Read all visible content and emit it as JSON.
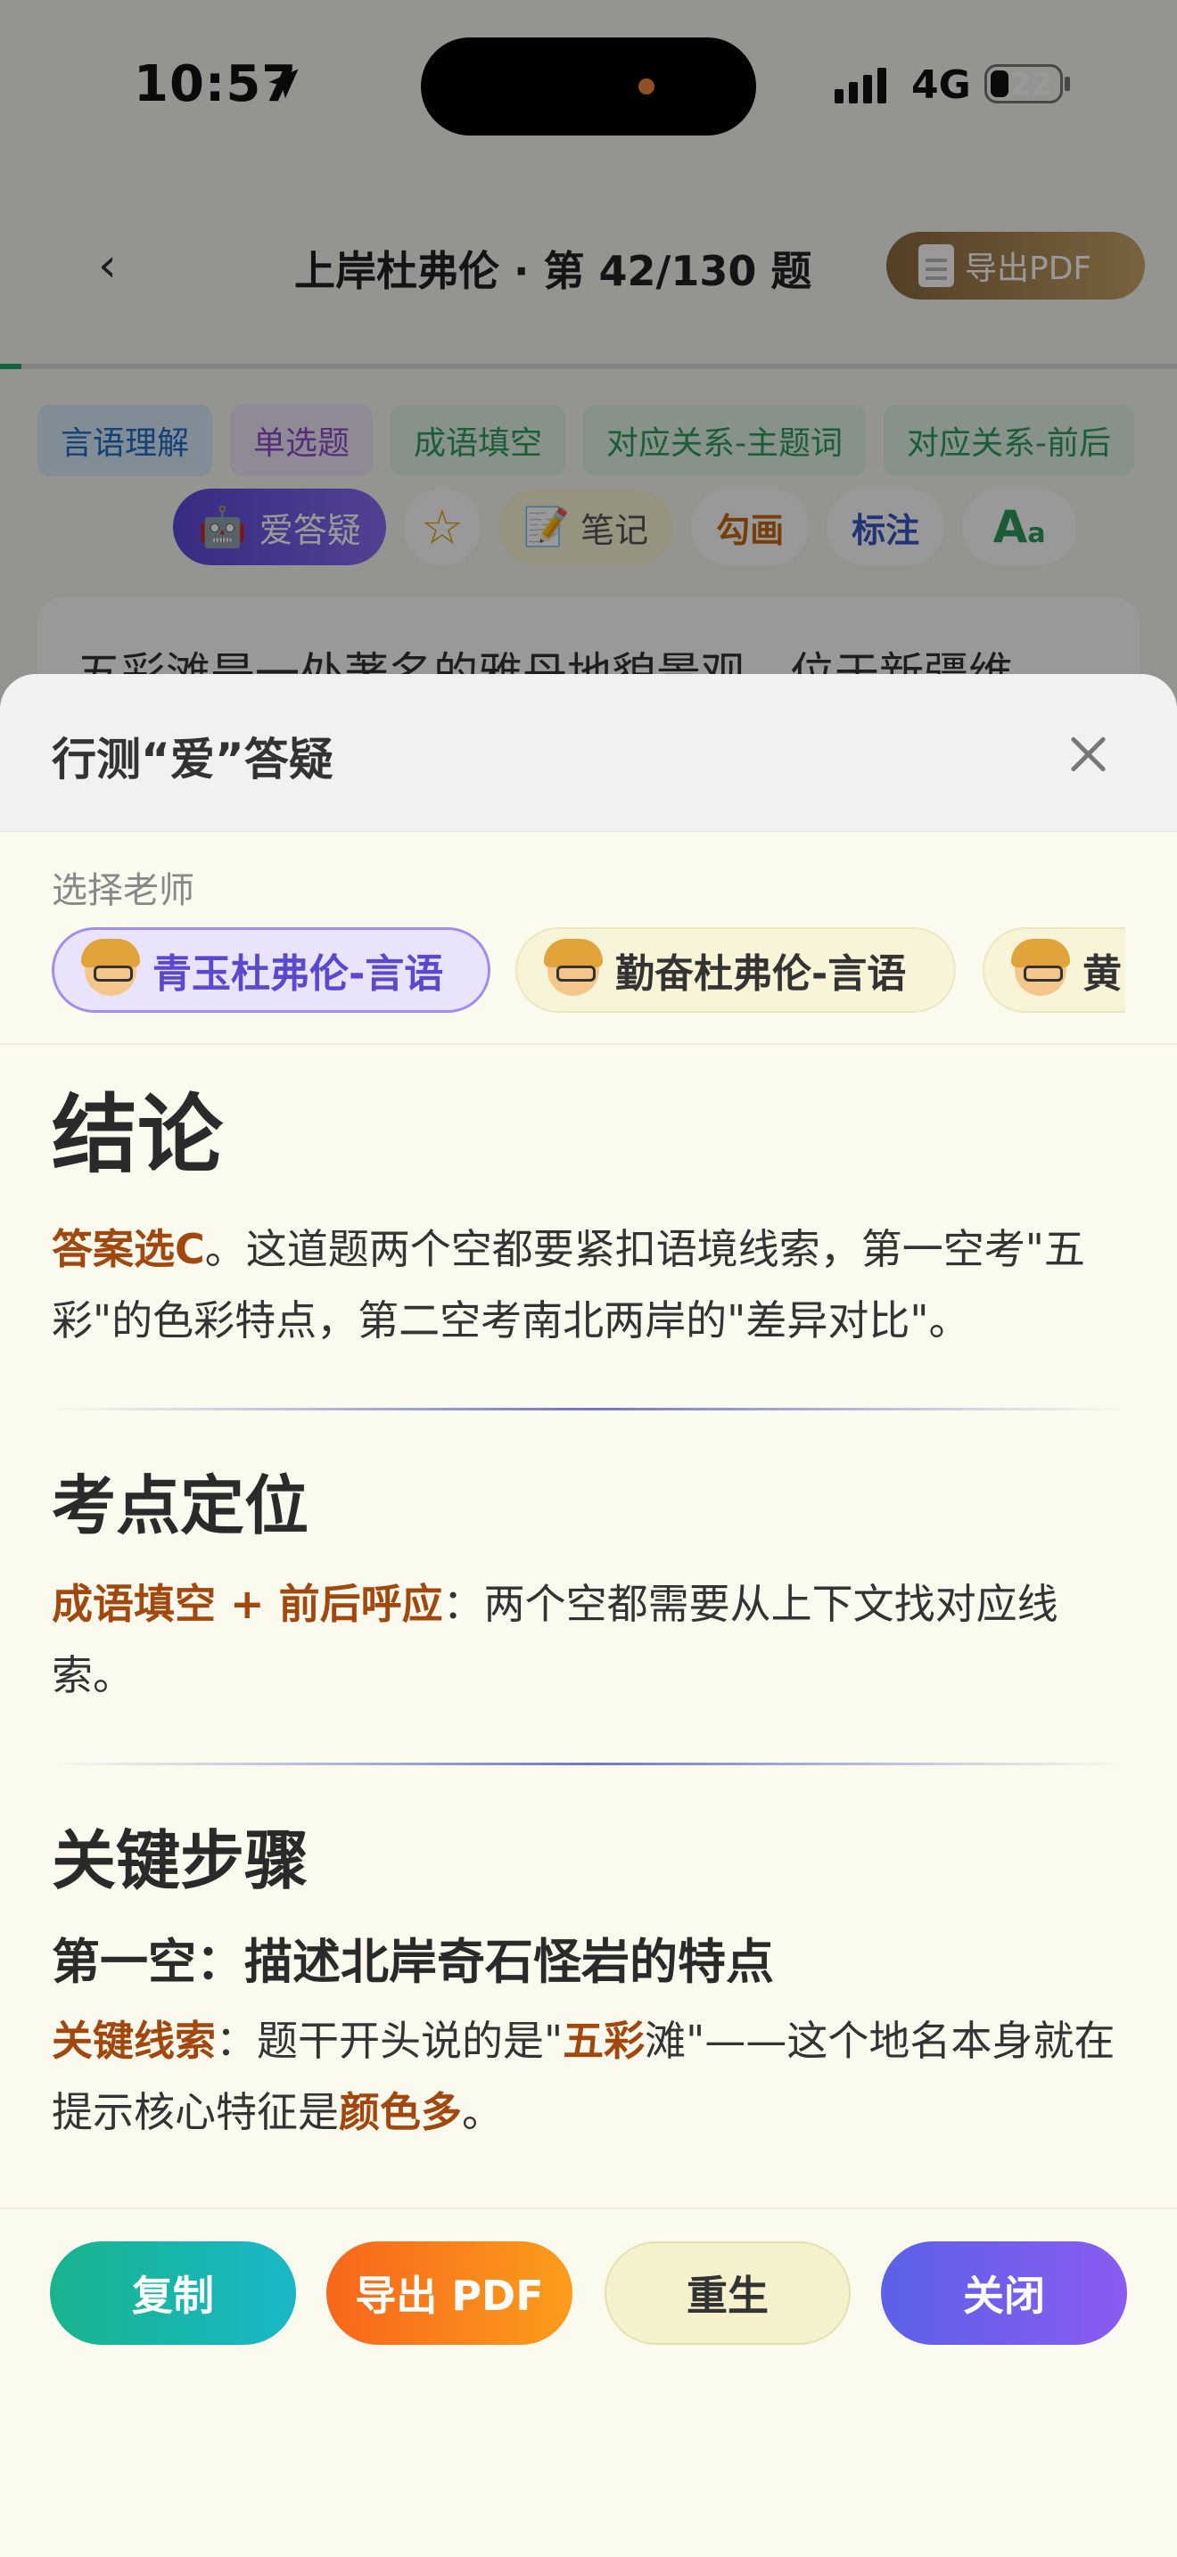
{
  "status": {
    "time": "10:57",
    "network": "4G",
    "battery": "22"
  },
  "nav": {
    "back": "‹",
    "title": "上岸杜弗伦 · 第 42/130 题",
    "export": "导出PDF"
  },
  "tags": [
    "言语理解",
    "单选题",
    "成语填空",
    "对应关系-主题词",
    "对应关系-前后"
  ],
  "toolbar": {
    "ai": "爱答疑",
    "star": "☆",
    "note": "笔记",
    "draw": "勾画",
    "mark": "标注",
    "font_big": "A",
    "font_small": "a"
  },
  "question_preview": "五彩滩是一处著名的雅丹地貌景观，位于新疆维",
  "sheet": {
    "title": "行测“爱”答疑",
    "choose_label": "选择老师",
    "teachers": [
      "青玉杜弗伦-言语",
      "勤奋杜弗伦-言语",
      "黄"
    ],
    "sections": {
      "conclusion": {
        "heading": "结论",
        "lead": "答案选C",
        "text": "。这道题两个空都要紧扣语境线索，第一空考\"五彩\"的色彩特点，第二空考南北两岸的\"差异对比\"。"
      },
      "point": {
        "heading": "考点定位",
        "lead": "成语填空 + 前后呼应",
        "text": "：两个空都需要从上下文找对应线索。"
      },
      "steps": {
        "heading": "关键步骤",
        "sub": "第一空：描述北岸奇石怪岩的特点",
        "lead": "关键线索",
        "t1": "：题干开头说的是\"",
        "k1": "五彩",
        "t2": "滩\"——这个地名本身就在提示核心特征是",
        "k2": "颜色多",
        "t3": "。"
      }
    },
    "buttons": {
      "copy": "复制",
      "export_pdf": "导出 PDF",
      "regen": "重生",
      "close": "关闭"
    }
  },
  "colors": {
    "accent_purple": "#5a49cf",
    "highlight": "#a2480f",
    "copy": "#18b48c",
    "pdf": "#f7661b",
    "close": "#5b61e8"
  }
}
